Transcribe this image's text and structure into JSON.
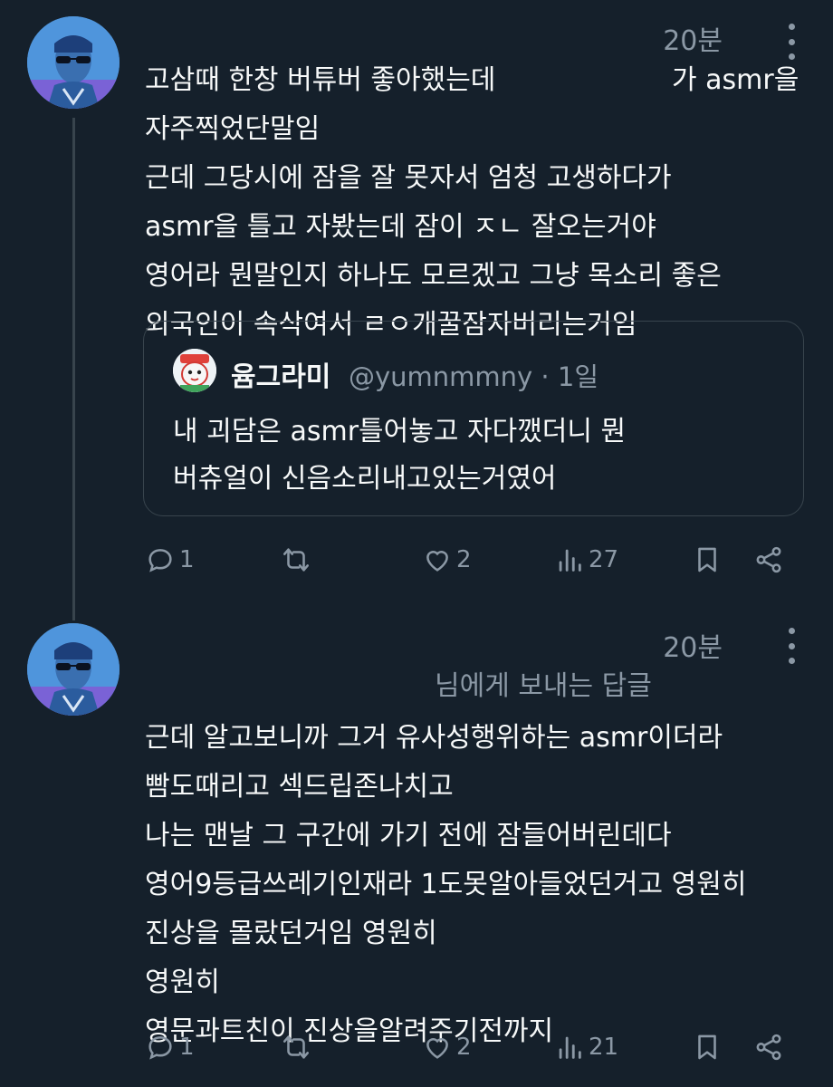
{
  "tweets": [
    {
      "time": "20분",
      "text_line1_a": "고삼때 한창 버튜버 좋아했는데",
      "text_line1_b": "가 asmr을",
      "lines": [
        "자주찍었단말임",
        "근데 그당시에 잠을 잘 못자서 엄청 고생하다가",
        "asmr을 틀고 자봤는데 잠이 ㅈㄴ 잘오는거야",
        "영어라 뭔말인지 하나도 모르겠고 그냥 목소리 좋은",
        "외국인이 속삭여서 ㄹㅇ개꿀잠자버리는거임"
      ],
      "quote": {
        "name": "윰그라미",
        "handle": "@yumnmmny · 1일",
        "lines": [
          "내 괴담은 asmr틀어놓고 자다깼더니 뭔",
          "버츄얼이 신음소리내고있는거였어"
        ]
      },
      "actions": {
        "replies": "1",
        "likes": "2",
        "views": "27"
      }
    },
    {
      "time": "20분",
      "reply_context": "님에게 보내는 답글",
      "lines": [
        "근데 알고보니까 그거 유사성행위하는 asmr이더라",
        "빰도때리고 섹드립존나치고",
        "나는 맨날 그 구간에 가기 전에 잠들어버린데다",
        "영어9등급쓰레기인재라 1도못알아들었던거고 영원히",
        "진상을 몰랐던거임 영원히",
        "영원히",
        "영문과트친이 진상을알려주기전까지"
      ],
      "actions": {
        "replies": "1",
        "likes": "2",
        "views": "21"
      }
    }
  ],
  "colors": {
    "background": "#15202b",
    "text": "#f7f9f9",
    "secondary": "#8b98a5",
    "border": "#38444d"
  },
  "icons": [
    "reply-icon",
    "retweet-icon",
    "like-icon",
    "views-icon",
    "bookmark-icon",
    "share-icon",
    "more-icon"
  ]
}
